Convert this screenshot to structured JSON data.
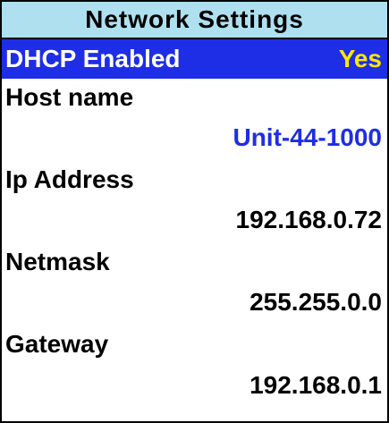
{
  "screen": {
    "title": "Network Settings",
    "colors": {
      "title_bg": "#aee0f0",
      "selected_bg": "#1e2ee6",
      "selected_value": "#ffe600",
      "edit_value": "#1e2ee6"
    }
  },
  "dhcp": {
    "label": "DHCP Enabled",
    "value": "Yes"
  },
  "hostname": {
    "label": "Host name",
    "value": "Unit-44-1000"
  },
  "ip": {
    "label": "Ip Address",
    "value": "192.168.0.72"
  },
  "netmask": {
    "label": "Netmask",
    "value": "255.255.0.0"
  },
  "gateway": {
    "label": "Gateway",
    "value": "192.168.0.1"
  }
}
